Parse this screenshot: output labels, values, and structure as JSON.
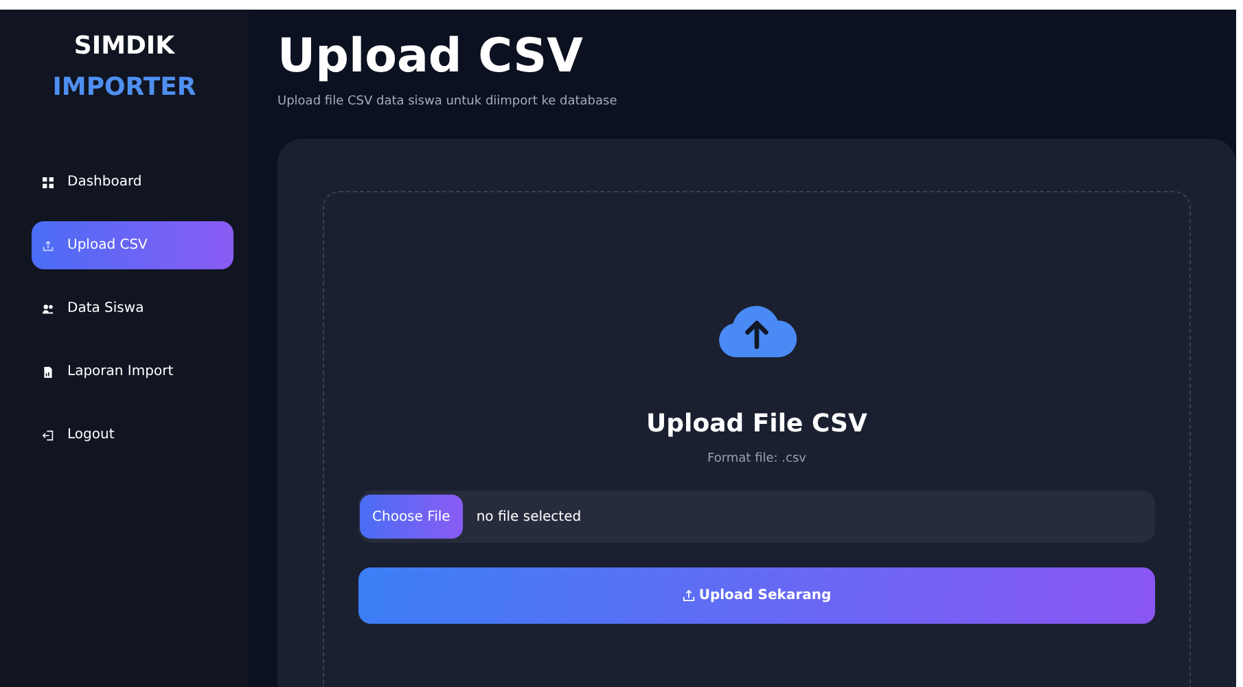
{
  "brand": {
    "line_1": "SIMDIK",
    "line_2": "IMPORTER"
  },
  "sidebar": {
    "items": [
      {
        "label": "Dashboard",
        "selected": false
      },
      {
        "label": "Upload CSV",
        "selected": true
      },
      {
        "label": "Data Siswa",
        "selected": false
      },
      {
        "label": "Laporan Import",
        "selected": false
      },
      {
        "label": "Logout",
        "selected": false
      }
    ]
  },
  "header": {
    "title": "Upload CSV",
    "subtitle": "Upload file CSV data siswa untuk diimport ke database"
  },
  "upload": {
    "title": "Upload File CSV",
    "hint": "Format file: .csv",
    "choose_button": "Choose File",
    "file_status": "no file selected",
    "submit_button": "Upload Sekarang"
  }
}
